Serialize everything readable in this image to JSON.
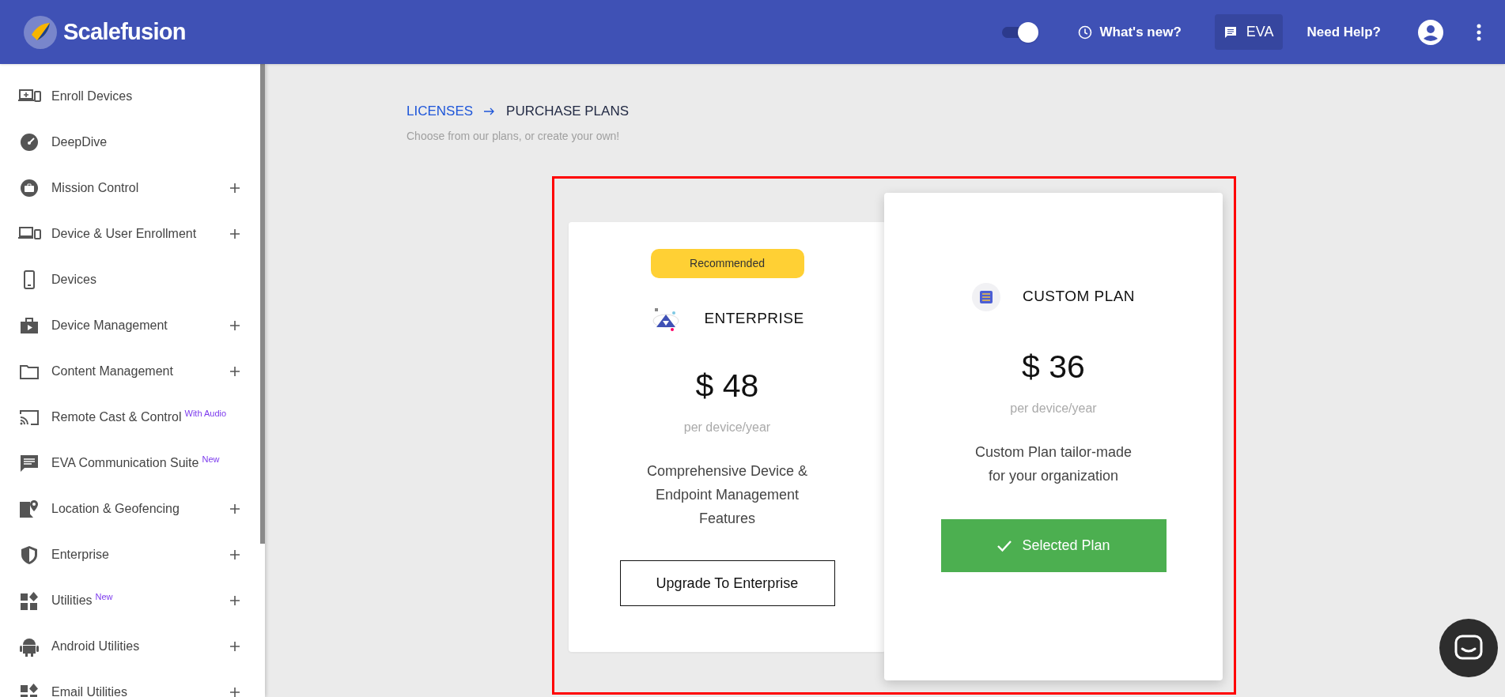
{
  "header": {
    "logo_text": "Scalefusion",
    "toggle": {
      "on": true
    },
    "whats_new": "What's new?",
    "eva": "EVA",
    "need_help": "Need Help?"
  },
  "sidebar": {
    "items": [
      {
        "label": "Enroll Devices",
        "expandable": false
      },
      {
        "label": "DeepDive",
        "expandable": false
      },
      {
        "label": "Mission Control",
        "expandable": true
      },
      {
        "label": "Device & User Enrollment",
        "expandable": true
      },
      {
        "label": "Devices",
        "expandable": false
      },
      {
        "label": "Device Management",
        "expandable": true
      },
      {
        "label": "Content Management",
        "expandable": true
      },
      {
        "label": "Remote Cast & Control",
        "badge": "With Audio",
        "expandable": false
      },
      {
        "label": "EVA Communication Suite",
        "badge": "New",
        "expandable": false
      },
      {
        "label": "Location & Geofencing",
        "expandable": true
      },
      {
        "label": "Enterprise",
        "expandable": true
      },
      {
        "label": "Utilities",
        "badge": "New",
        "expandable": true
      },
      {
        "label": "Android Utilities",
        "expandable": true
      },
      {
        "label": "Email Utilities",
        "expandable": true
      }
    ]
  },
  "breadcrumb": [
    {
      "label": "LICENSES",
      "kind": "link"
    },
    {
      "label": "PURCHASE PLANS",
      "kind": "current"
    }
  ],
  "subtitle": "Choose from our plans, or create your own!",
  "plans": [
    {
      "kind": "enterprise",
      "badge": "Recommended",
      "name": "ENTERPRISE",
      "price": "$ 48",
      "unit": "per device/year",
      "description": "Comprehensive Device & Endpoint Management Features",
      "button": "Upgrade To Enterprise",
      "selected": false
    },
    {
      "kind": "custom",
      "name": "CUSTOM PLAN",
      "price": "$ 36",
      "unit": "per device/year",
      "description": "Custom Plan tailor-made for your organization",
      "button": "Selected Plan",
      "selected": true
    }
  ]
}
